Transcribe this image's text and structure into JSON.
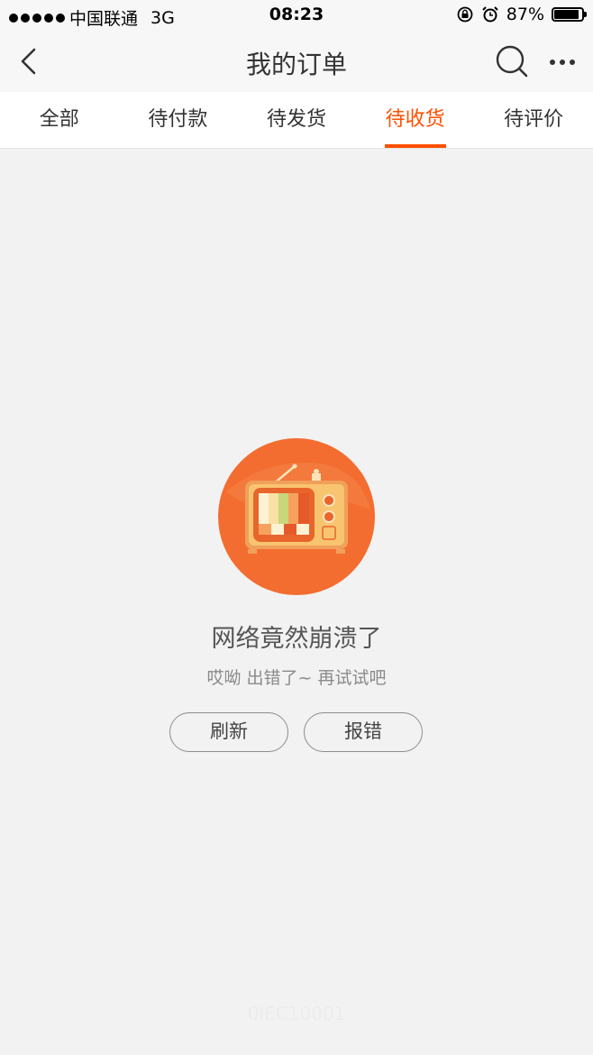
{
  "status_bar": {
    "carrier": "中国联通",
    "network": "3G",
    "time": "08:23",
    "battery_text": "87%",
    "battery_level": 0.87
  },
  "nav": {
    "title": "我的订单",
    "back_icon": "chevron-left-icon",
    "search_icon": "search-icon",
    "more_icon": "more-horizontal-icon"
  },
  "tabs": [
    {
      "label": "全部",
      "active": false
    },
    {
      "label": "待付款",
      "active": false
    },
    {
      "label": "待发货",
      "active": false
    },
    {
      "label": "待收货",
      "active": true
    },
    {
      "label": "待评价",
      "active": false
    }
  ],
  "error": {
    "title": "网络竟然崩溃了",
    "subtitle": "哎呦 出错了~ 再试试吧",
    "refresh_label": "刷新",
    "report_label": "报错"
  },
  "footer": {
    "code": "0IEC10001"
  },
  "colors": {
    "accent": "#ff5000",
    "background": "#f2f2f2",
    "illustration": "#f36d30"
  }
}
